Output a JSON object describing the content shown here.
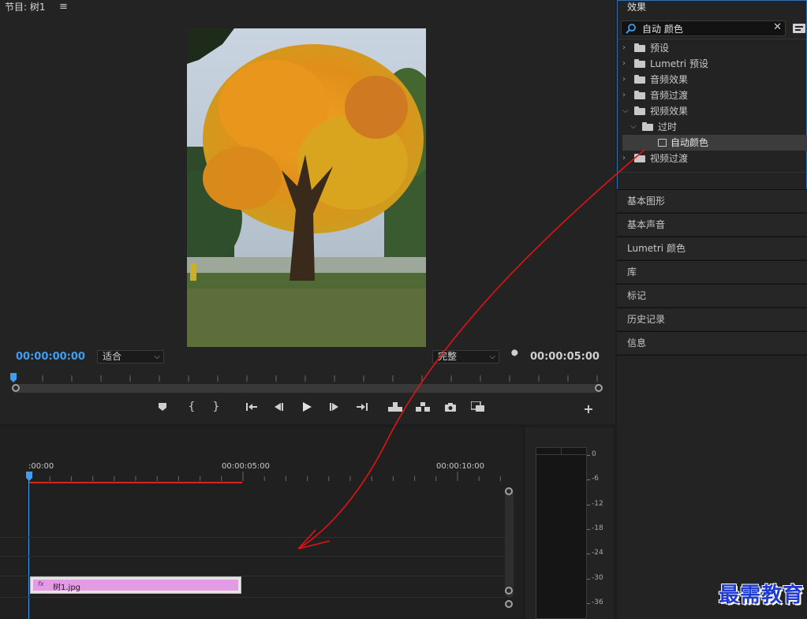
{
  "program_monitor": {
    "tab_title": "节目: 树1",
    "menu_icon": "hamburger-icon",
    "timecode_current": "00:00:00:00",
    "timecode_duration": "00:00:05:00",
    "fit_select": "适合",
    "quality_select": "完整",
    "playhead_fraction": 0,
    "transport_icons": [
      "marker-icon",
      "mark-in-icon",
      "mark-out-icon",
      "go-to-in-icon",
      "step-back-icon",
      "play-icon",
      "step-forward-icon",
      "go-to-out-icon",
      "lift-icon",
      "extract-icon",
      "export-frame-icon",
      "comparison-view-icon",
      "add-button-icon"
    ]
  },
  "timeline": {
    "times": [
      ":00:00",
      "00:00:05:00",
      "00:00:10:00"
    ],
    "clip": {
      "fx_badge": "fx",
      "name": "树1.jpg"
    }
  },
  "audio_meter": {
    "ticks": [
      "0",
      "-6",
      "-12",
      "-18",
      "-24",
      "-30",
      "-36"
    ]
  },
  "effects_panel": {
    "title": "效果",
    "search_value": "自动 颜色",
    "tree": [
      {
        "label": "预设",
        "level": 0,
        "expanded": false,
        "icon": "preset-folder-icon"
      },
      {
        "label": "Lumetri 预设",
        "level": 0,
        "expanded": false,
        "icon": "preset-folder-icon"
      },
      {
        "label": "音频效果",
        "level": 0,
        "expanded": false,
        "icon": "folder-icon"
      },
      {
        "label": "音频过渡",
        "level": 0,
        "expanded": false,
        "icon": "folder-icon"
      },
      {
        "label": "视频效果",
        "level": 0,
        "expanded": true,
        "icon": "folder-icon"
      },
      {
        "label": "过时",
        "level": 1,
        "expanded": true,
        "icon": "folder-icon"
      },
      {
        "label": "自动颜色",
        "level": 2,
        "selected": true,
        "icon": "effect-icon"
      },
      {
        "label": "视频过渡",
        "level": 0,
        "expanded": false,
        "icon": "folder-icon"
      }
    ]
  },
  "side_panels": [
    "基本图形",
    "基本声音",
    "Lumetri 颜色",
    "库",
    "标记",
    "历史记录",
    "信息"
  ],
  "watermark": "最需教育",
  "colors": {
    "accent_blue": "#3f9df2",
    "clip_pink": "#e49be6",
    "annotation_red": "#e01414"
  }
}
